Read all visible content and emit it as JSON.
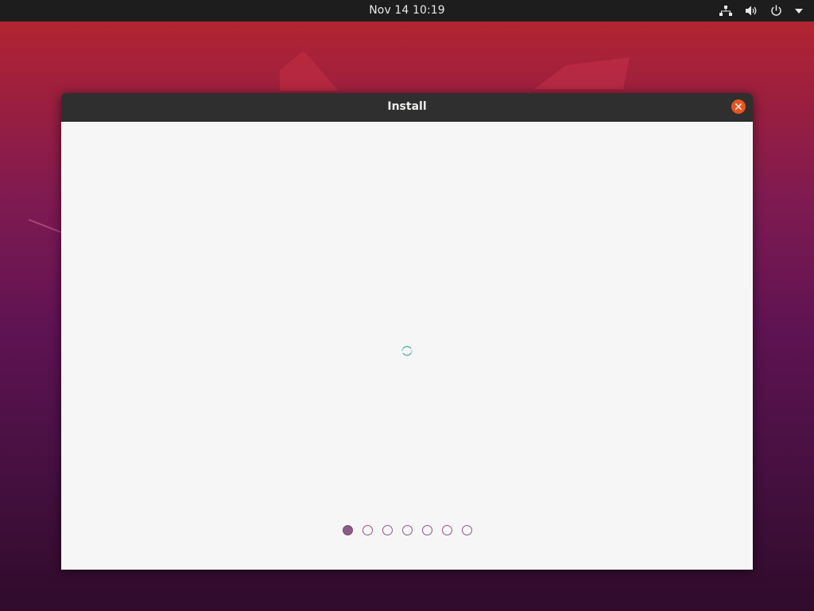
{
  "topbar": {
    "datetime": "Nov 14  10:19",
    "tray_icons": [
      "network-wired-icon",
      "speaker-volume-icon",
      "power-icon",
      "dropdown-arrow-icon"
    ]
  },
  "window": {
    "title": "Install",
    "close_icon": "close-icon",
    "close_color": "#e95420",
    "loading_indicator": "spinner-icon",
    "steps": {
      "total": 7,
      "current": 1
    }
  },
  "colors": {
    "accent": "#8c5a87",
    "titlebar": "#2f2f2f",
    "content_bg": "#f6f6f6"
  }
}
